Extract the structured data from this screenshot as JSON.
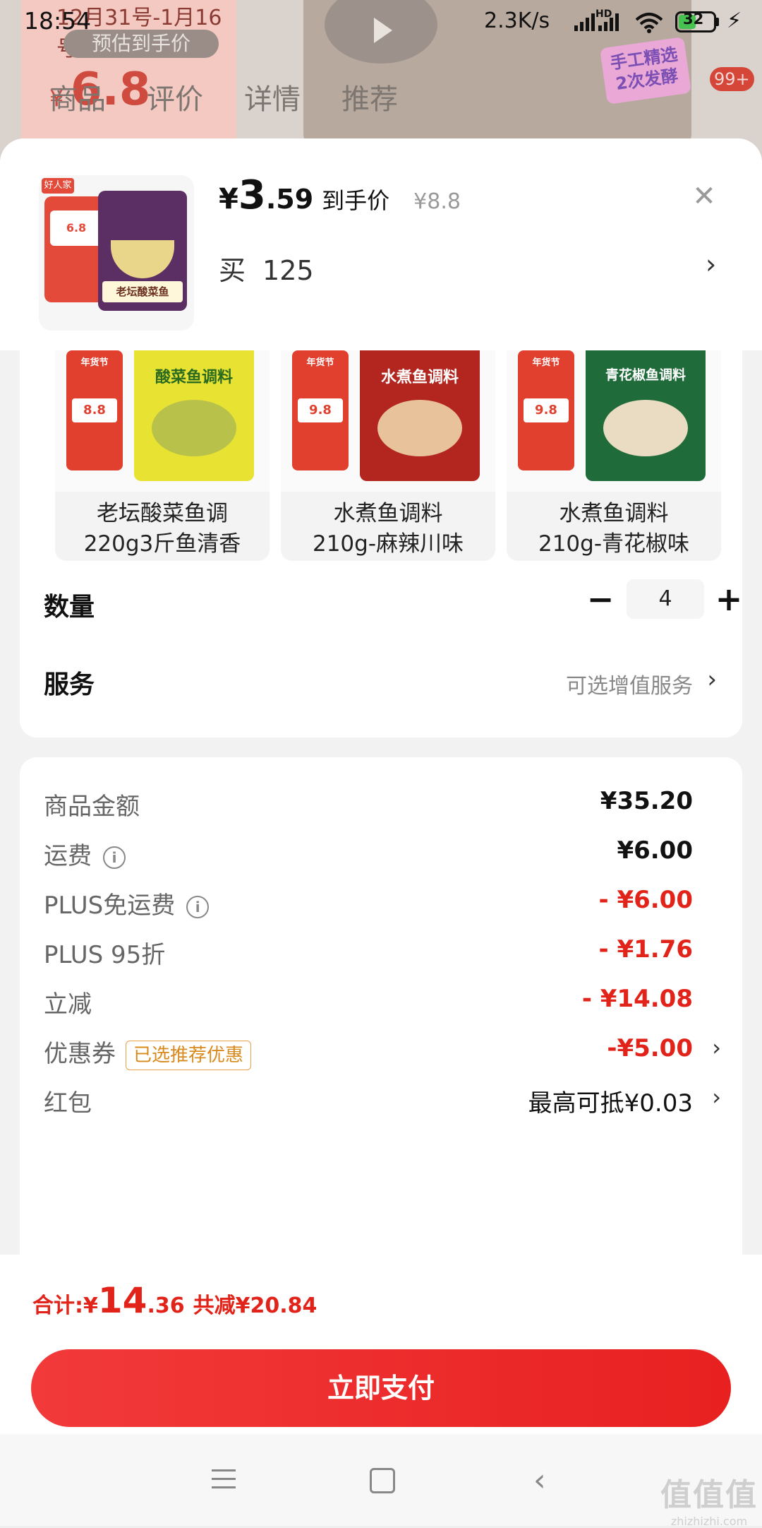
{
  "status_bar": {
    "time": "18:54",
    "net_speed": "2.3K/s",
    "network_label": "HD",
    "battery": "32"
  },
  "background": {
    "promo_date": "12月31号-1月16号",
    "promo_pill": "预估到手价",
    "promo_yen": "¥",
    "promo_price": "6.8",
    "sticker_text": "手工精选 2次发酵",
    "tabs": [
      "商品",
      "评价",
      "详情",
      "推荐"
    ],
    "badge": "99+"
  },
  "product": {
    "thumb_logo": "好人家",
    "thumb_tag": "6.8",
    "thumb_name": "老坛酸菜鱼",
    "price_currency": "¥",
    "price_integer": "3",
    "price_decimal": ".59",
    "price_label": "到手价",
    "original_price": "¥8.8",
    "buy_label": "买",
    "buy_count": "125"
  },
  "variants": [
    {
      "mini_title": "年货节",
      "mini_price": "8.8",
      "pack_name": "酸菜鱼调料",
      "caption_line1": "老坛酸菜鱼调",
      "caption_line2": "220g3斤鱼清香",
      "pack_color": "#e8e233",
      "dish_color": "#b8c24a",
      "name_color": "#2a6b1f"
    },
    {
      "mini_title": "年货节",
      "mini_price": "9.8",
      "pack_name": "水煮鱼调料",
      "caption_line1": "水煮鱼调料",
      "caption_line2": "210g-麻辣川味",
      "pack_color": "#b2261f",
      "dish_color": "#e8c29a",
      "name_color": "#ffffff"
    },
    {
      "mini_title": "年货节",
      "mini_price": "9.8",
      "pack_name": "青花椒鱼调料",
      "caption_line1": "水煮鱼调料",
      "caption_line2": "210g-青花椒味",
      "pack_color": "#1f6b3a",
      "dish_color": "#e9dcc2",
      "name_color": "#ffffff"
    }
  ],
  "quantity": {
    "label": "数量",
    "value": "4"
  },
  "service": {
    "label": "服务",
    "value": "可选增值服务"
  },
  "fees": [
    {
      "label": "商品金额",
      "value": "¥35.20",
      "red": false,
      "info": false,
      "chevron": false
    },
    {
      "label": "运费",
      "value": "¥6.00",
      "red": false,
      "info": true,
      "chevron": false
    },
    {
      "label": "PLUS免运费",
      "value": "- ¥6.00",
      "red": true,
      "info": true,
      "chevron": false
    },
    {
      "label": "PLUS 95折",
      "value": "- ¥1.76",
      "red": true,
      "info": false,
      "chevron": false
    },
    {
      "label": "立减",
      "value": "- ¥14.08",
      "red": true,
      "info": false,
      "chevron": false
    },
    {
      "label": "优惠券",
      "tag": "已选推荐优惠",
      "value": "-¥5.00",
      "red": true,
      "info": false,
      "chevron": true
    },
    {
      "label": "红包",
      "value": "最高可抵¥0.03",
      "red": false,
      "info": false,
      "chevron": true
    }
  ],
  "total": {
    "label": "合计:",
    "currency": "¥",
    "integer": "14",
    "decimal": ".36",
    "saved": "共减¥20.84"
  },
  "pay_button": "立即支付",
  "watermark": {
    "big": "值值值",
    "small": "zhizhizhi.com"
  },
  "colors": {
    "accent": "#e2231a",
    "pay_button": "#f03030"
  }
}
